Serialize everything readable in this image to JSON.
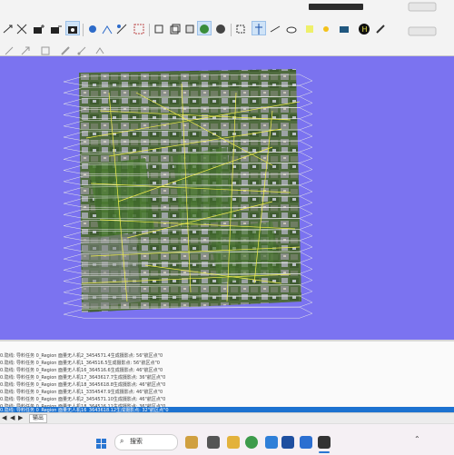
{
  "log": {
    "rows": [
      "0.隐线: 导料任务 0_Region 面量无人机2_3454571.4生成摄影点: 56\"航区点\"0",
      "0.隐线: 导料任务 0_Region 面量无人机1_364516.5生成摄影点: 56\"航区点\"0",
      "0.隐线: 导料任务 0_Region 面量无人机16_364516.6生成摄影点: 46\"航区点\"0",
      "0.隐线: 导料任务 0_Region 面量无人机17_3643617.7生成摄影点: 36\"航区点\"0",
      "0.隐线: 导料任务 0_Region 面量无人机18_3645618.8生成摄影点: 46\"航区点\"0",
      "0.隐线: 导料任务 0_Region 面量无人机1_3354547.9生成摄影点: 46\"航区点\"0",
      "0.隐线: 导料任务 0_Region 面量无人机2_3454571.10生成摄影点: 46\"航区点\"0",
      "0.隐线: 导料任务 0_Region 面量无人机18_364516.11生成摄影点: 36\"航区点\"0",
      "0.隐线: 导料任务 0_Region 面量无人机16_3643618.12生成摄影点: 32\"航区点\"0"
    ]
  },
  "status": {
    "tab_label": "输出"
  },
  "taskbar": {
    "search_placeholder": "搜索"
  },
  "colors": {
    "viewport_bg": "#7b73f0",
    "selection": "#1c72d0",
    "flight_lines": "#f2ef4a"
  }
}
